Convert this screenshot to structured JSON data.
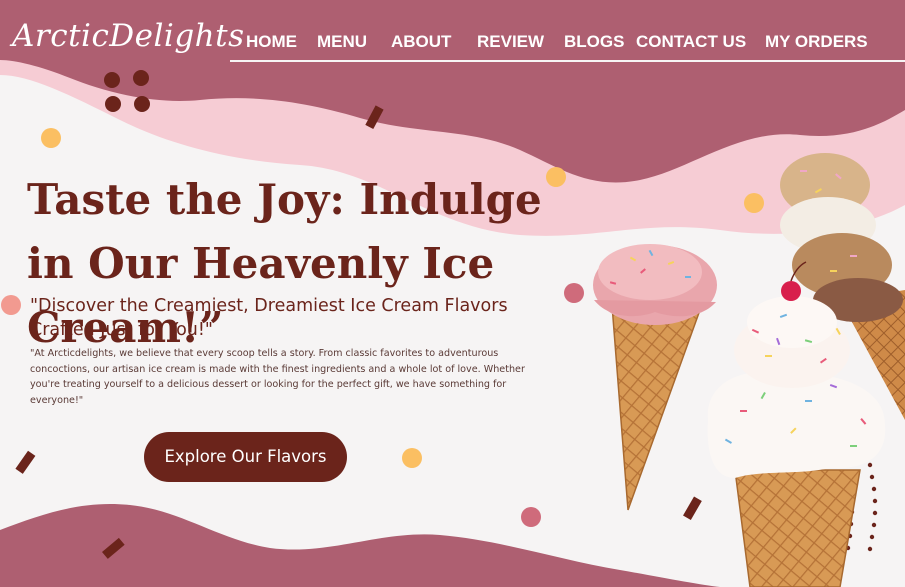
{
  "brand": {
    "logo_text": "ArcticDelights"
  },
  "nav": {
    "items": [
      {
        "label": "HOME"
      },
      {
        "label": "MENU"
      },
      {
        "label": "ABOUT"
      },
      {
        "label": "REVIEW"
      },
      {
        "label": "BLOGS"
      },
      {
        "label": "CONTACT US"
      },
      {
        "label": "MY ORDERS"
      }
    ]
  },
  "hero": {
    "headline": "Taste the Joy: Indulge in Our Heavenly Ice Cream!”",
    "subheadline": "\"Discover the Creamiest, Dreamiest Ice Cream Flavors Crafted Just for You!\"",
    "body": "\"At Arcticdelights, we believe that every scoop tells a story. From classic favorites to adventurous concoctions, our artisan ice cream is made with the finest ingredients and a whole lot of love. Whether you're treating yourself to a delicious dessert or looking for the perfect gift, we have something for everyone!\"",
    "cta_label": "Explore Our Flavors"
  },
  "colors": {
    "mauve": "#ae5f71",
    "pink": "#f6ccd4",
    "brown": "#6b241b",
    "orange_dot": "#fbbf62",
    "salmon_dot": "#f29a90",
    "rose_dot": "#cf6b7b",
    "background": "#f6f4f4"
  },
  "images": {
    "cone_left": "ice-cream-cone-strawberry",
    "cone_right": "ice-cream-cone-stacked-sprinkles"
  }
}
